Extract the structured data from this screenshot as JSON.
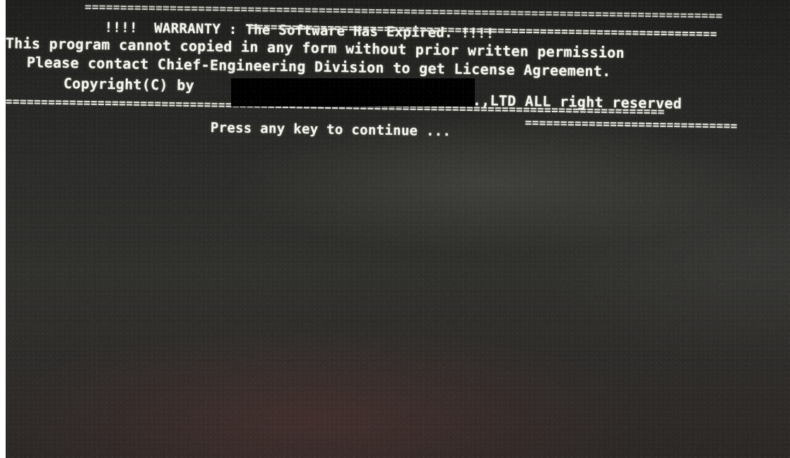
{
  "screen": {
    "rule_top": "==========================================================================================",
    "warranty_line": "!!!!  WARRANTY : The Software Has Expired. !!!!",
    "rule_top_2": "==================================================================",
    "copied_line": "This program cannot copied in any form without prior written permission",
    "contact_line": "Please contact Chief-Engineering Division to get License Agreement.",
    "copyright_line": "Copyright(C) by",
    "reserved_line": ".,LTD ALL right reserved",
    "rule_bottom": "=============================================================================================",
    "press_line": "Press any key to continue ...",
    "rule_bottom_2": "=============================="
  },
  "colors": {
    "text": "#f4f4ee",
    "screen_background": "#2b2b29",
    "redaction": "#000000"
  }
}
